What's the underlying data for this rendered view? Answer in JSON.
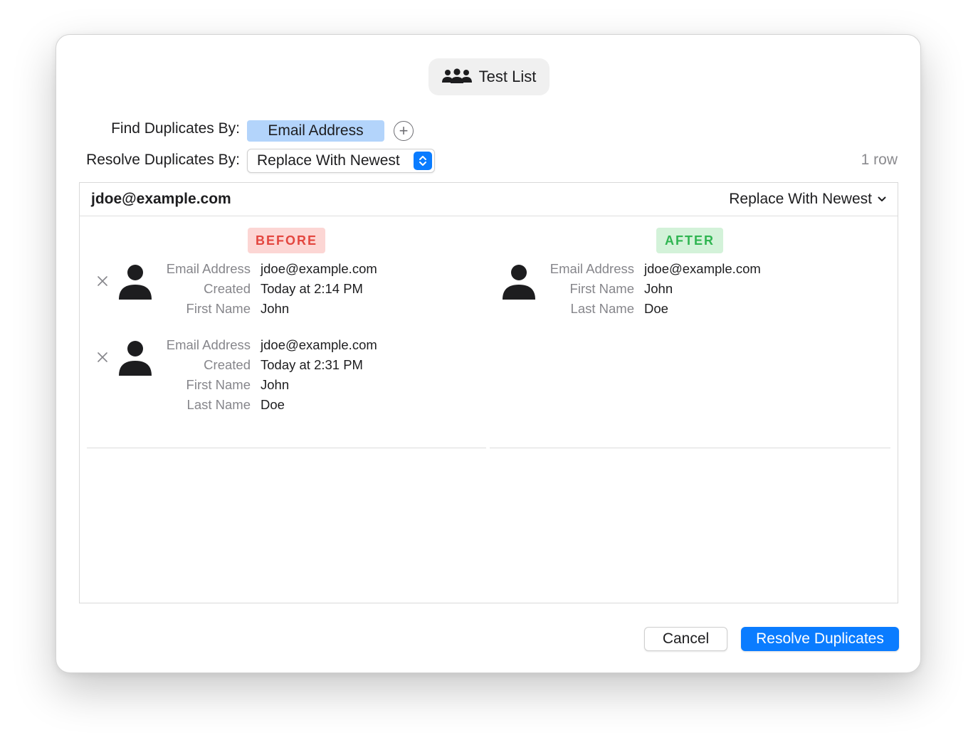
{
  "list": {
    "title": "Test List",
    "icon": "people-group-icon"
  },
  "find_by": {
    "label": "Find Duplicates By:",
    "tokens": [
      "Email Address"
    ],
    "add_icon": "plus-circle-icon"
  },
  "resolve_by": {
    "label": "Resolve Duplicates By:",
    "selected": "Replace With Newest"
  },
  "row_count": "1 row",
  "group": {
    "email": "jdoe@example.com",
    "action": "Replace With Newest",
    "before_label": "BEFORE",
    "after_label": "AFTER",
    "before_records": [
      {
        "fields": [
          {
            "key": "Email Address",
            "value": "jdoe@example.com"
          },
          {
            "key": "Created",
            "value": "Today at 2:14 PM"
          },
          {
            "key": "First Name",
            "value": "John"
          }
        ]
      },
      {
        "fields": [
          {
            "key": "Email Address",
            "value": "jdoe@example.com"
          },
          {
            "key": "Created",
            "value": "Today at 2:31 PM"
          },
          {
            "key": "First Name",
            "value": "John"
          },
          {
            "key": "Last Name",
            "value": "Doe"
          }
        ]
      }
    ],
    "after_record": {
      "fields": [
        {
          "key": "Email Address",
          "value": "jdoe@example.com"
        },
        {
          "key": "First Name",
          "value": "John"
        },
        {
          "key": "Last Name",
          "value": "Doe"
        }
      ]
    }
  },
  "buttons": {
    "cancel": "Cancel",
    "resolve": "Resolve Duplicates"
  },
  "colors": {
    "accent": "#0a7cff",
    "token_bg": "#b3d4fb",
    "before_bg": "#fcd6d4",
    "before_text": "#e3463f",
    "after_bg": "#d3f2d9",
    "after_text": "#2fb551"
  }
}
